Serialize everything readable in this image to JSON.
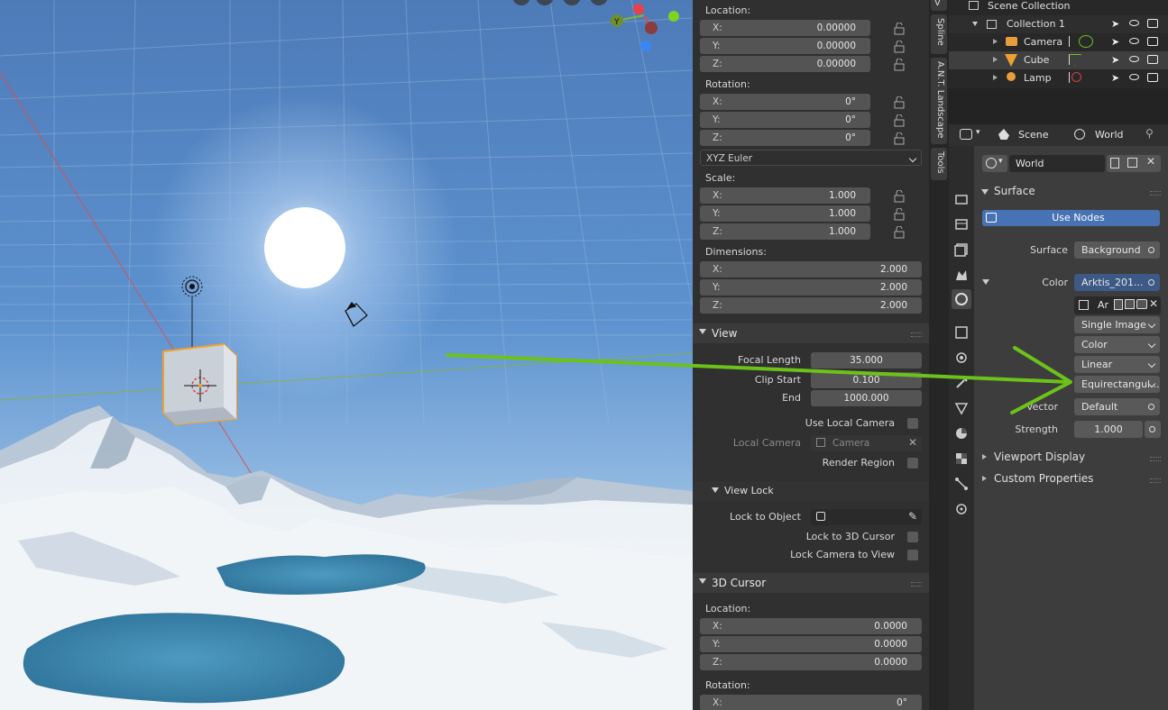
{
  "npanel": {
    "location_label": "Location:",
    "location": [
      {
        "axis": "X:",
        "value": "0.00000"
      },
      {
        "axis": "Y:",
        "value": "0.00000"
      },
      {
        "axis": "Z:",
        "value": "0.00000"
      }
    ],
    "rotation_label": "Rotation:",
    "rotation": [
      {
        "axis": "X:",
        "value": "0°"
      },
      {
        "axis": "Y:",
        "value": "0°"
      },
      {
        "axis": "Z:",
        "value": "0°"
      }
    ],
    "rotation_mode": "XYZ Euler",
    "scale_label": "Scale:",
    "scale": [
      {
        "axis": "X:",
        "value": "1.000"
      },
      {
        "axis": "Y:",
        "value": "1.000"
      },
      {
        "axis": "Z:",
        "value": "1.000"
      }
    ],
    "dimensions_label": "Dimensions:",
    "dimensions": [
      {
        "axis": "X:",
        "value": "2.000"
      },
      {
        "axis": "Y:",
        "value": "2.000"
      },
      {
        "axis": "Z:",
        "value": "2.000"
      }
    ],
    "view_header": "View",
    "focal_length_label": "Focal Length",
    "focal_length": "35.000",
    "clip_start_label": "Clip Start",
    "clip_start": "0.100",
    "clip_end_label": "End",
    "clip_end": "1000.000",
    "use_local_camera": "Use Local Camera",
    "local_camera_label": "Local Camera",
    "local_camera_placeholder": "Camera",
    "render_region": "Render Region",
    "view_lock_header": "View Lock",
    "lock_to_object": "Lock to Object",
    "lock_to_3d_cursor": "Lock to 3D Cursor",
    "lock_camera_to_view": "Lock Camera to View",
    "cursor_header": "3D Cursor",
    "cursor_location_label": "Location:",
    "cursor_location": [
      {
        "axis": "X:",
        "value": "0.0000"
      },
      {
        "axis": "Y:",
        "value": "0.0000"
      },
      {
        "axis": "Z:",
        "value": "0.0000"
      }
    ],
    "cursor_rotation_label": "Rotation:",
    "cursor_rotation": [
      {
        "axis": "X:",
        "value": "0°"
      }
    ]
  },
  "tabs": [
    "View",
    "Spline",
    "A.N.T. Landscape",
    "Tools"
  ],
  "tab_view_visible": "V",
  "outliner": {
    "root": "Scene Collection",
    "collection": "Collection 1",
    "items": [
      "Camera",
      "Cube",
      "Lamp"
    ]
  },
  "properties": {
    "scene_label": "Scene",
    "world_label": "World",
    "world_name": "World",
    "surface_header": "Surface",
    "use_nodes": "Use Nodes",
    "surface_label": "Surface",
    "surface_value": "Background",
    "color_label": "Color",
    "color_value": "Arktis_201...",
    "image_short": "Ar",
    "image_source": "Single Image",
    "color_space": "Color",
    "interpolation": "Linear",
    "projection": "Equirectangul...",
    "vector_label": "Vector",
    "vector_value": "Default",
    "strength_label": "Strength",
    "strength_value": "1.000",
    "viewport_display": "Viewport Display",
    "custom_properties": "Custom Properties"
  },
  "gizmo": {
    "y_label": "Y"
  },
  "colors": {
    "accent_blue": "#4772b3",
    "arrow_green": "#6dc21a",
    "selected_orange": "#f0a030"
  }
}
